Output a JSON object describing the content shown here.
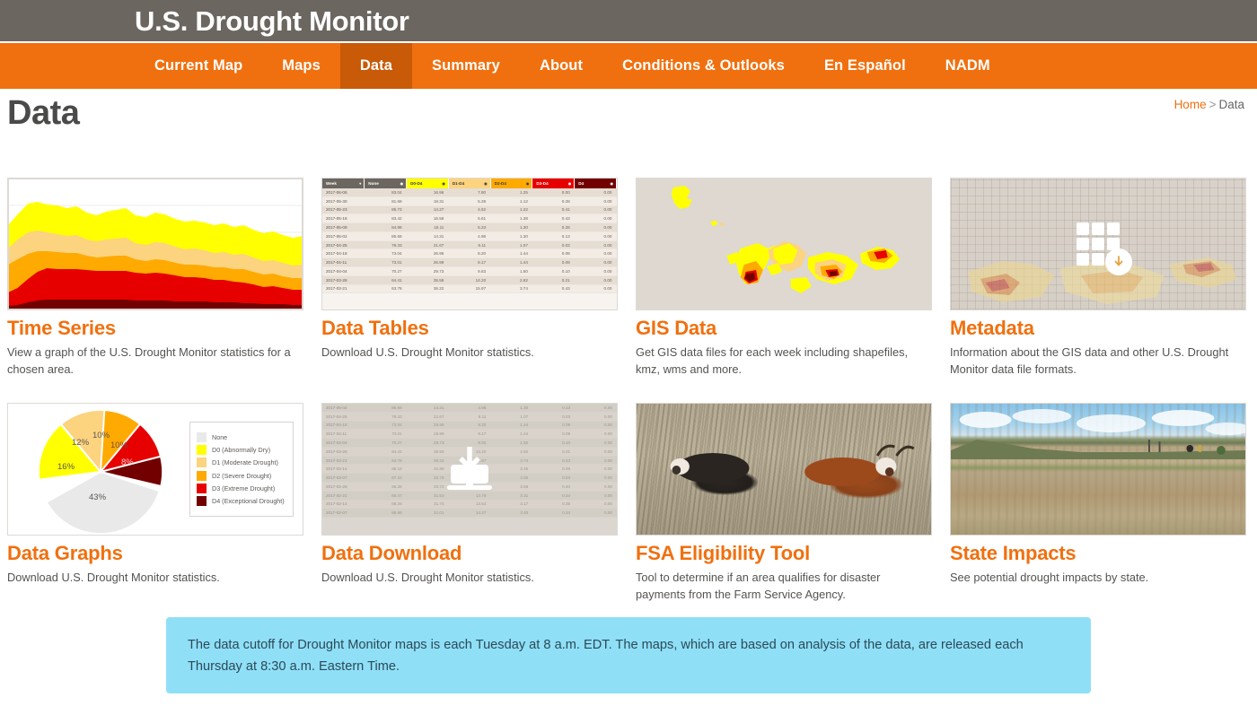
{
  "header": {
    "title": "U.S. Drought Monitor"
  },
  "nav": {
    "items": [
      {
        "label": "Current Map",
        "active": false
      },
      {
        "label": "Maps",
        "active": false
      },
      {
        "label": "Data",
        "active": true
      },
      {
        "label": "Summary",
        "active": false
      },
      {
        "label": "About",
        "active": false
      },
      {
        "label": "Conditions & Outlooks",
        "active": false
      },
      {
        "label": "En Español",
        "active": false
      },
      {
        "label": "NADM",
        "active": false
      }
    ]
  },
  "page": {
    "title": "Data",
    "breadcrumb": {
      "home": "Home",
      "separator": ">",
      "current": "Data"
    }
  },
  "cards": [
    {
      "title": "Time Series",
      "desc": "View a graph of the U.S. Drought Monitor statistics for a chosen area.",
      "thumb": "stacked-area-chart"
    },
    {
      "title": "Data Tables",
      "desc": "Download U.S. Drought Monitor statistics.",
      "thumb": "data-table"
    },
    {
      "title": "GIS Data",
      "desc": "Get GIS data files for each week including shapefiles, kmz, wms and more.",
      "thumb": "drought-map"
    },
    {
      "title": "Metadata",
      "desc": "Information about the GIS data and other U.S. Drought Monitor data file formats.",
      "thumb": "grid-download-icon"
    },
    {
      "title": "Data Graphs",
      "desc": "Download U.S. Drought Monitor statistics.",
      "thumb": "pie-chart"
    },
    {
      "title": "Data Download",
      "desc": "Download U.S. Drought Monitor statistics.",
      "thumb": "download-icon-table"
    },
    {
      "title": "FSA Eligibility Tool",
      "desc": "Tool to determine if an area qualifies for disaster payments from the Farm Service Agency.",
      "thumb": "cattle-photo"
    },
    {
      "title": "State Impacts",
      "desc": "See potential drought impacts by state.",
      "thumb": "dry-field-photo"
    }
  ],
  "banner": {
    "text": "The data cutoff for Drought Monitor maps is each Tuesday at 8 a.m. EDT. The maps, which are based on analysis of the data, are released each Thursday at 8:30 a.m. Eastern Time."
  },
  "colors": {
    "brand_orange": "#f0700f",
    "nav_active": "#c85a08",
    "header_gray": "#6b6660",
    "banner_blue": "#8fdff7",
    "d0": "#ffff00",
    "d1": "#fcd37f",
    "d2": "#ffaa00",
    "d3": "#e60000",
    "d4": "#730000",
    "none": "#e9e9e9"
  },
  "chart_data": [
    {
      "type": "area",
      "id": "time-series-thumb",
      "title": "",
      "xlabel": "",
      "ylabel": "",
      "stacked": true,
      "grid": true,
      "ylim": [
        0,
        100
      ],
      "legend_position": "none",
      "x": [
        0,
        1,
        2,
        3,
        4,
        5,
        6,
        7,
        8,
        9,
        10,
        11,
        12,
        13,
        14,
        15,
        16,
        17,
        18,
        19,
        20,
        21,
        22,
        23,
        24,
        25,
        26,
        27,
        28,
        29,
        30
      ],
      "series": [
        {
          "name": "D4 (Exceptional Drought)",
          "color": "#730000",
          "values": [
            0,
            0,
            1,
            3,
            4,
            4,
            4,
            4,
            4,
            4,
            4,
            4,
            4,
            4,
            4,
            4,
            4,
            4,
            4,
            4,
            4,
            3,
            3,
            3,
            3,
            3,
            3,
            3,
            3,
            3,
            3
          ]
        },
        {
          "name": "D3 (Extreme Drought)",
          "color": "#e60000",
          "values": [
            2,
            4,
            9,
            14,
            16,
            15,
            15,
            15,
            15,
            15,
            15,
            15,
            15,
            15,
            15,
            15,
            15,
            14,
            14,
            14,
            13,
            13,
            12,
            12,
            12,
            11,
            11,
            11,
            11,
            11,
            11
          ]
        },
        {
          "name": "D2 (Severe Drought)",
          "color": "#ffaa00",
          "values": [
            14,
            18,
            21,
            22,
            23,
            23,
            23,
            23,
            22,
            22,
            22,
            21,
            21,
            20,
            20,
            20,
            20,
            20,
            20,
            19,
            19,
            19,
            19,
            18,
            18,
            18,
            18,
            18,
            17,
            17,
            17
          ]
        },
        {
          "name": "D1 (Moderate Drought)",
          "color": "#fcd37f",
          "values": [
            16,
            18,
            20,
            21,
            21,
            21,
            21,
            21,
            21,
            21,
            21,
            21,
            21,
            21,
            21,
            20,
            20,
            20,
            20,
            20,
            20,
            19,
            19,
            19,
            19,
            19,
            18,
            18,
            18,
            18,
            18
          ]
        },
        {
          "name": "D0 (Abnormally Dry)",
          "color": "#ffff00",
          "values": [
            22,
            25,
            28,
            30,
            29,
            28,
            28,
            27,
            26,
            26,
            26,
            25,
            25,
            26,
            26,
            26,
            25,
            24,
            23,
            23,
            22,
            22,
            21,
            20,
            20,
            19,
            18,
            18,
            17,
            17,
            17
          ]
        }
      ]
    },
    {
      "type": "pie",
      "id": "data-graphs-thumb",
      "title": "",
      "legend_position": "right",
      "labels": [
        "None",
        "D0 (Abnormally Dry)",
        "D1 (Moderate Drought)",
        "D2 (Severe Drought)",
        "D3 (Extreme Drought)",
        "D4 (Exceptional Drought)"
      ],
      "values": [
        43,
        16,
        12,
        10,
        10,
        8
      ],
      "value_labels": [
        "43%",
        "16%",
        "12%",
        "10%",
        "10%",
        "8%"
      ],
      "colors": [
        "#e9e9e9",
        "#ffff00",
        "#fcd37f",
        "#ffaa00",
        "#e60000",
        "#730000"
      ]
    },
    {
      "type": "table",
      "id": "data-tables-thumb",
      "columns": [
        "Week",
        "None",
        "D0-D4",
        "D1-D4",
        "D2-D4",
        "D3-D4",
        "D4"
      ],
      "column_colors": [
        "#6b6660",
        "#6b6660",
        "#ffff00",
        "#fcd37f",
        "#ffaa00",
        "#e60000",
        "#730000"
      ],
      "rows": [
        [
          "2017-06-06",
          "83.04",
          "16.96",
          "7.80",
          "1.25",
          "0.00",
          "0.00"
        ],
        [
          "2017-05-30",
          "81.69",
          "18.31",
          "5.28",
          "1.12",
          "0.28",
          "0.00"
        ],
        [
          "2017-05-23",
          "85.73",
          "14.27",
          "4.52",
          "1.22",
          "0.41",
          "0.00"
        ],
        [
          "2017-05-16",
          "83.42",
          "16.58",
          "5.61",
          "1.38",
          "0.43",
          "0.00"
        ],
        [
          "2017-05-09",
          "84.89",
          "15.11",
          "5.23",
          "1.30",
          "0.28",
          "0.00"
        ],
        [
          "2017-05-02",
          "85.69",
          "14.31",
          "4.98",
          "1.30",
          "0.13",
          "0.00"
        ],
        [
          "2017-04-25",
          "78.33",
          "21.67",
          "6.11",
          "1.07",
          "0.03",
          "0.00"
        ],
        [
          "2017-04-18",
          "73.04",
          "26.96",
          "8.20",
          "1.44",
          "0.09",
          "0.00"
        ],
        [
          "2017-04-11",
          "73.01",
          "26.99",
          "8.17",
          "1.44",
          "0.09",
          "0.00"
        ],
        [
          "2017-04-04",
          "70.27",
          "29.73",
          "9.83",
          "1.50",
          "0.10",
          "0.00"
        ],
        [
          "2017-03-28",
          "64.41",
          "35.59",
          "14.20",
          "2.82",
          "0.21",
          "0.00"
        ],
        [
          "2017-03-21",
          "63.78",
          "36.22",
          "15.97",
          "3.74",
          "0.43",
          "0.00"
        ]
      ]
    },
    {
      "type": "table",
      "id": "data-download-thumb",
      "columns": [
        "Week",
        "None",
        "D0-D4",
        "D1-D4",
        "D2-D4",
        "D3-D4",
        "D4"
      ],
      "rows": [
        [
          "2017-05-02",
          "85.69",
          "14.31",
          "4.98",
          "1.30",
          "0.13",
          "0.00"
        ],
        [
          "2017-04-25",
          "78.33",
          "21.67",
          "6.11",
          "1.07",
          "0.03",
          "0.00"
        ],
        [
          "2017-04-18",
          "73.04",
          "26.96",
          "8.20",
          "1.44",
          "0.09",
          "0.00"
        ],
        [
          "2017-04-11",
          "73.01",
          "26.99",
          "8.17",
          "1.44",
          "0.09",
          "0.00"
        ],
        [
          "2017-04-04",
          "70.27",
          "29.73",
          "9.83",
          "1.50",
          "0.10",
          "0.00"
        ],
        [
          "2017-03-28",
          "64.41",
          "35.59",
          "14.20",
          "2.82",
          "0.21",
          "0.00"
        ],
        [
          "2017-03-21",
          "63.78",
          "36.22",
          "15.97",
          "3.74",
          "0.43",
          "0.00"
        ],
        [
          "2017-03-14",
          "68.14",
          "31.86",
          "13.45",
          "3.45",
          "0.49",
          "0.00"
        ],
        [
          "2017-03-07",
          "67.22",
          "32.78",
          "13.97",
          "4.00",
          "0.53",
          "0.00"
        ],
        [
          "2017-02-28",
          "66.28",
          "33.72",
          "14.40",
          "3.68",
          "0.40",
          "0.00"
        ],
        [
          "2017-02-21",
          "68.47",
          "31.53",
          "13.78",
          "3.31",
          "0.34",
          "0.00"
        ],
        [
          "2017-02-14",
          "68.26",
          "31.74",
          "13.54",
          "3.17",
          "0.35",
          "0.00"
        ],
        [
          "2017-02-07",
          "68.99",
          "31.01",
          "14.27",
          "3.40",
          "0.34",
          "0.00"
        ]
      ]
    }
  ]
}
